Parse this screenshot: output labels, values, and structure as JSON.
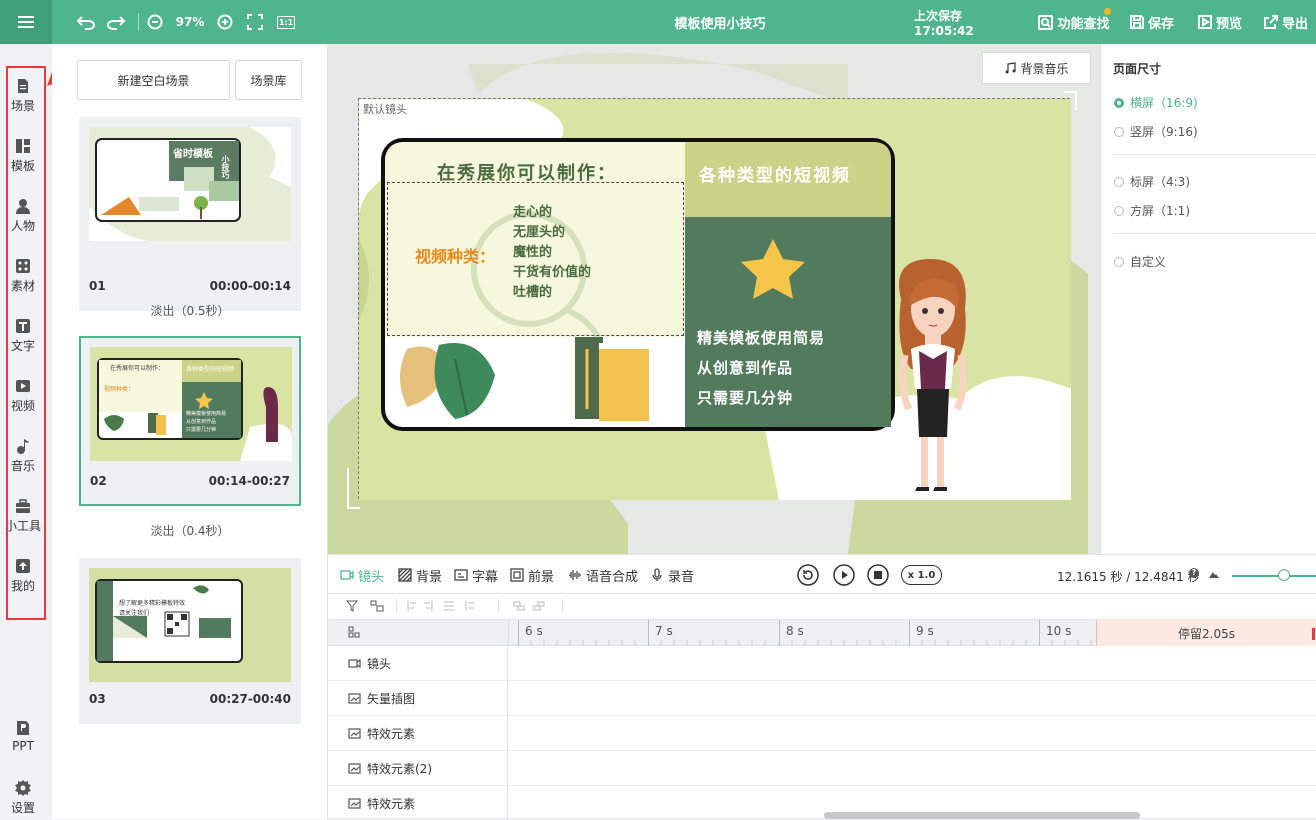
{
  "topbar": {
    "title": "模板使用小技巧",
    "zoom": "97%",
    "ratio_btn": "1:1",
    "last_saved": "上次保存 17:05:42",
    "find_feature": "功能查找",
    "save": "保存",
    "preview": "预览",
    "export": "导出"
  },
  "rail": [
    {
      "label": "场景",
      "icon": "scene-icon"
    },
    {
      "label": "模板",
      "icon": "template-icon"
    },
    {
      "label": "人物",
      "icon": "person-icon"
    },
    {
      "label": "素材",
      "icon": "material-icon"
    },
    {
      "label": "文字",
      "icon": "text-icon"
    },
    {
      "label": "视频",
      "icon": "video-icon"
    },
    {
      "label": "音乐",
      "icon": "music-icon"
    },
    {
      "label": "小工具",
      "icon": "toolbox-icon"
    },
    {
      "label": "我的",
      "icon": "upload-icon"
    },
    {
      "label": "PPT",
      "icon": "ppt-icon"
    },
    {
      "label": "设置",
      "icon": "gear-icon"
    }
  ],
  "scene_panel": {
    "new_blank": "新建空白场景",
    "library": "场景库",
    "scenes": [
      {
        "num": "01",
        "time": "00:00-00:14"
      },
      {
        "num": "02",
        "time": "00:14-00:27"
      },
      {
        "num": "03",
        "time": "00:27-00:40"
      }
    ],
    "transitions": [
      "淡出（0.5秒）",
      "淡出（0.4秒）"
    ]
  },
  "canvas": {
    "bg_music": "背景音乐",
    "default_lens": "默认镜头",
    "card_title": "在秀展你可以制作：",
    "card_category": "视频种类：",
    "card_list": [
      "走心的",
      "无厘头的",
      "魔性的",
      "干货有价值的",
      "吐槽的"
    ],
    "card_right_title": "各种类型的短视频",
    "card_lines": [
      "精美模板使用简易",
      "从创意到作品",
      "只需要几分钟"
    ]
  },
  "thumb_texts": {
    "s1_title": "省时模板",
    "s1_side": "小技巧",
    "s2_title": "在秀展你可以制作：",
    "s2_right": "各种类型的短视频",
    "s2_cat": "视频种类：",
    "s2_lines": [
      "精美模板使用简易",
      "从创意到作品",
      "只需要几分钟"
    ],
    "s3_l1": "想了解更多精彩模板特效",
    "s3_l2": "请关注我们"
  },
  "page_size": {
    "title": "页面尺寸",
    "options": [
      "横屏（16:9)",
      "竖屏（9:16)",
      "标屏（4:3)",
      "方屏（1:1)",
      "自定义"
    ],
    "selected": 0
  },
  "timeline": {
    "tabs": [
      "镜头",
      "背景",
      "字幕",
      "前景",
      "语音合成",
      "录音"
    ],
    "time": "12.1615 秒 / 12.4841 秒",
    "speed": "x 1.0",
    "ticks": [
      "6 s",
      "7 s",
      "8 s",
      "9 s",
      "10 s"
    ],
    "pause": "停留2.05s",
    "tracks": [
      "镜头",
      "矢量插图",
      "特效元素",
      "特效元素(2)",
      "特效元素"
    ]
  },
  "colors": {
    "accent": "#4eb58c",
    "annotation": "#e83a3a",
    "card_green": "#527a5c"
  }
}
